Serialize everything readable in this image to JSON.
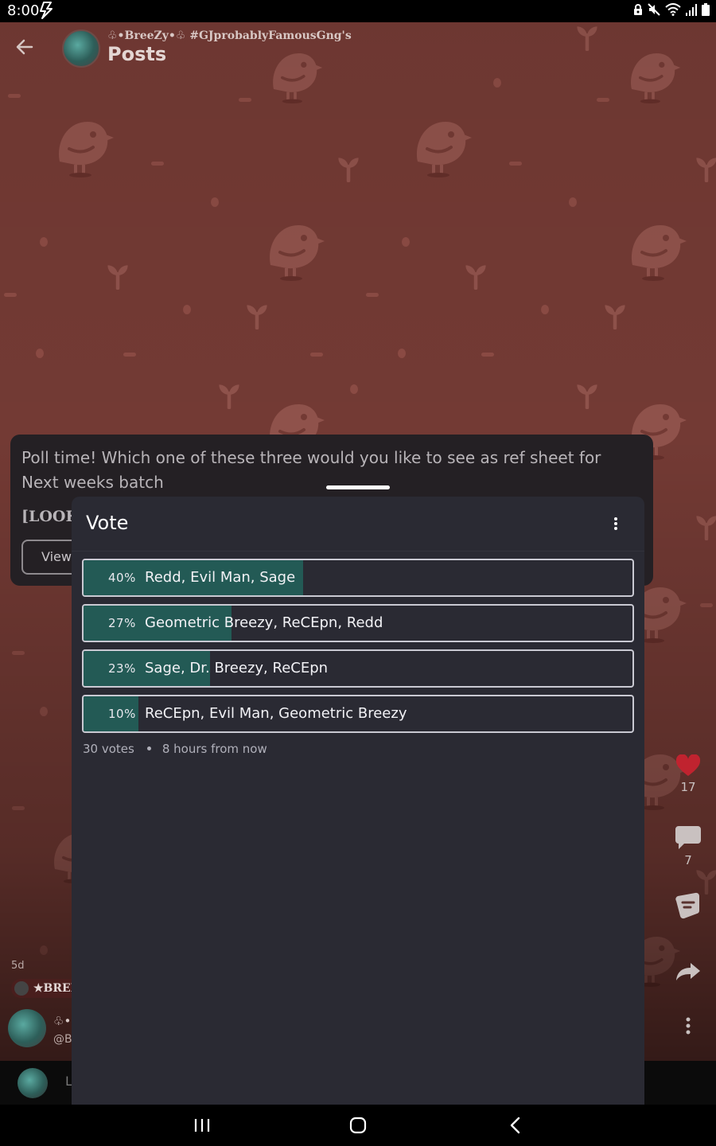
{
  "status_bar": {
    "time": "8:00"
  },
  "header": {
    "subtitle": "♧•BreeZy•♧ #GJprobablyFamousGng's",
    "title": "Posts"
  },
  "post": {
    "text": "Poll time! Which one of these three would you like to see as ref sheet for Next weeks batch",
    "look_text": "[LOOK",
    "view_button": "View",
    "age": "5d",
    "badge_text": "★BREEZY",
    "author_name": "♧•BreeZy",
    "author_handle": "@BreeZy",
    "comment_placeholder": "L"
  },
  "actions": {
    "likes": "17",
    "comments": "7"
  },
  "vote_sheet": {
    "title": "Vote",
    "options": [
      {
        "percent_label": "40%",
        "value": 40,
        "label": "Redd, Evil Man, Sage"
      },
      {
        "percent_label": "27%",
        "value": 27,
        "label": "Geometric Breezy, ReCEpn, Redd"
      },
      {
        "percent_label": "23%",
        "value": 23,
        "label": "Sage, Dr. Breezy, ReCEpn"
      },
      {
        "percent_label": "10%",
        "value": 10,
        "label": "ReCEpn, Evil Man, Geometric Breezy"
      }
    ],
    "votes": "30 votes",
    "time_left": "8 hours from now"
  },
  "colors": {
    "background_red": "#733a34",
    "poll_fill": "#235a55",
    "sheet_bg": "#2a2a33",
    "like_heart": "#c0232f"
  }
}
